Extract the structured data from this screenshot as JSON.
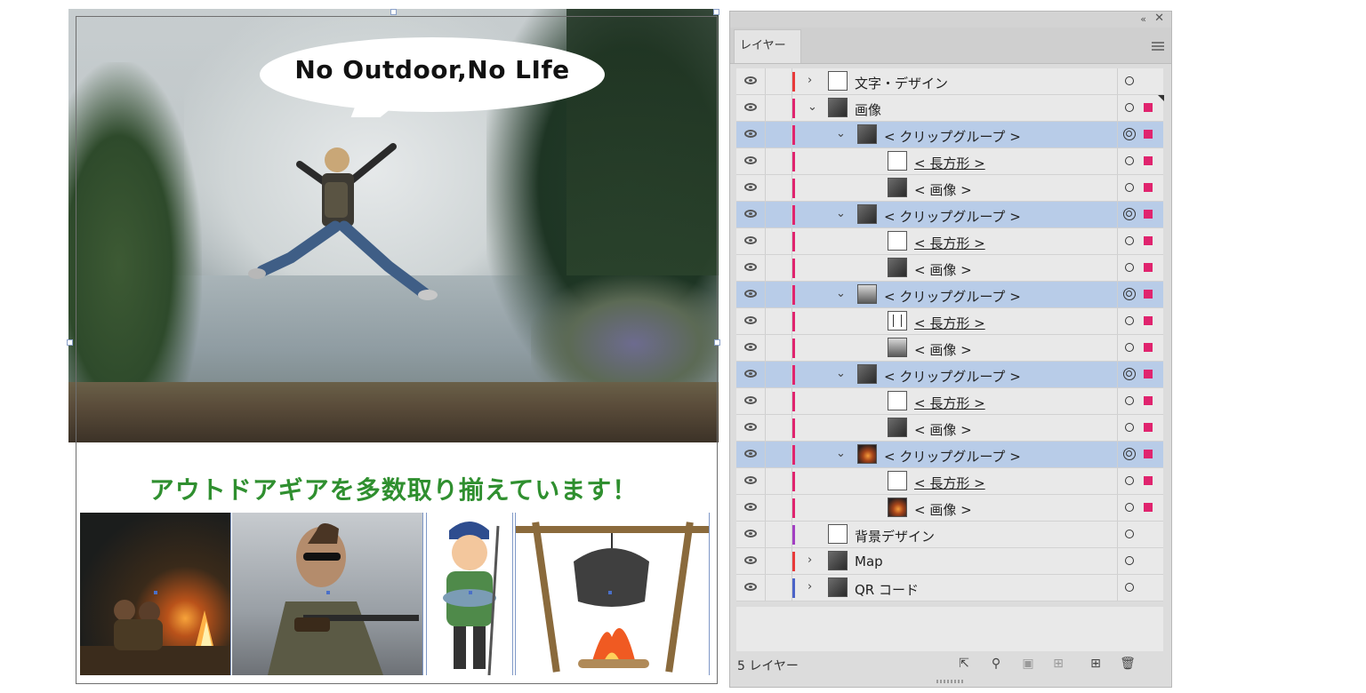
{
  "canvas": {
    "speech_bubble": "No Outdoor,No LIfe",
    "headline": "アウトドアギアを多数取り揃えています！"
  },
  "panel": {
    "tab_label": "レイヤー",
    "footer_count": "5 レイヤー",
    "layers": [
      {
        "name": "文字・デザイン",
        "level": 0,
        "chevron": "›",
        "thumb": "doc",
        "color": "#e83a3a",
        "selected": false,
        "target": "single",
        "sel": "",
        "underline": false
      },
      {
        "name": "画像",
        "level": 0,
        "chevron": "⌄",
        "thumb": "img",
        "color": "#e0246e",
        "selected": false,
        "target": "single",
        "sel": "#e0246e",
        "underline": false,
        "corner": true
      },
      {
        "name": "< クリップグループ >",
        "level": 1,
        "chevron": "⌄",
        "thumb": "img",
        "color": "#e0246e",
        "selected": true,
        "target": "double",
        "sel": "#e0246e",
        "underline": false
      },
      {
        "name": "< 長方形 >",
        "level": 2,
        "chevron": "",
        "thumb": "blank",
        "color": "#e0246e",
        "selected": false,
        "target": "single",
        "sel": "#e0246e",
        "underline": true
      },
      {
        "name": "< 画像 >",
        "level": 2,
        "chevron": "",
        "thumb": "img",
        "color": "#e0246e",
        "selected": false,
        "target": "single",
        "sel": "#e0246e",
        "underline": false
      },
      {
        "name": "< クリップグループ >",
        "level": 1,
        "chevron": "⌄",
        "thumb": "img",
        "color": "#e0246e",
        "selected": true,
        "target": "double",
        "sel": "#e0246e",
        "underline": false
      },
      {
        "name": "< 長方形 >",
        "level": 2,
        "chevron": "",
        "thumb": "blank",
        "color": "#e0246e",
        "selected": false,
        "target": "single",
        "sel": "#e0246e",
        "underline": true
      },
      {
        "name": "< 画像 >",
        "level": 2,
        "chevron": "",
        "thumb": "img",
        "color": "#e0246e",
        "selected": false,
        "target": "single",
        "sel": "#e0246e",
        "underline": false
      },
      {
        "name": "< クリップグループ >",
        "level": 1,
        "chevron": "⌄",
        "thumb": "person",
        "color": "#e0246e",
        "selected": true,
        "target": "double",
        "sel": "#e0246e",
        "underline": false
      },
      {
        "name": "< 長方形 >",
        "level": 2,
        "chevron": "",
        "thumb": "lines",
        "color": "#e0246e",
        "selected": false,
        "target": "single",
        "sel": "#e0246e",
        "underline": true
      },
      {
        "name": "< 画像 >",
        "level": 2,
        "chevron": "",
        "thumb": "person",
        "color": "#e0246e",
        "selected": false,
        "target": "single",
        "sel": "#e0246e",
        "underline": false
      },
      {
        "name": "< クリップグループ >",
        "level": 1,
        "chevron": "⌄",
        "thumb": "img",
        "color": "#e0246e",
        "selected": true,
        "target": "double",
        "sel": "#e0246e",
        "underline": false
      },
      {
        "name": "< 長方形 >",
        "level": 2,
        "chevron": "",
        "thumb": "blank",
        "color": "#e0246e",
        "selected": false,
        "target": "single",
        "sel": "#e0246e",
        "underline": true
      },
      {
        "name": "< 画像 >",
        "level": 2,
        "chevron": "",
        "thumb": "img",
        "color": "#e0246e",
        "selected": false,
        "target": "single",
        "sel": "#e0246e",
        "underline": false
      },
      {
        "name": "< クリップグループ >",
        "level": 1,
        "chevron": "⌄",
        "thumb": "fire",
        "color": "#e0246e",
        "selected": true,
        "target": "double",
        "sel": "#e0246e",
        "underline": false
      },
      {
        "name": "< 長方形 >",
        "level": 2,
        "chevron": "",
        "thumb": "blank",
        "color": "#e0246e",
        "selected": false,
        "target": "single",
        "sel": "#e0246e",
        "underline": true
      },
      {
        "name": "< 画像 >",
        "level": 2,
        "chevron": "",
        "thumb": "fire",
        "color": "#e0246e",
        "selected": false,
        "target": "single",
        "sel": "#e0246e",
        "underline": false
      },
      {
        "name": "背景デザイン",
        "level": 0,
        "chevron": "",
        "thumb": "blank",
        "color": "#a23fc2",
        "selected": false,
        "target": "single",
        "sel": "",
        "underline": false
      },
      {
        "name": "Map",
        "level": 0,
        "chevron": "›",
        "thumb": "img",
        "color": "#e83a3a",
        "selected": false,
        "target": "single",
        "sel": "",
        "underline": false
      },
      {
        "name": "QR コード",
        "level": 0,
        "chevron": "›",
        "thumb": "img",
        "color": "#4b63c8",
        "selected": false,
        "target": "single",
        "sel": "",
        "underline": false
      }
    ],
    "footer_icons": [
      "export-icon",
      "search-icon",
      "clip-mask-icon",
      "sublayer-icon",
      "new-layer-icon",
      "trash-icon"
    ]
  }
}
